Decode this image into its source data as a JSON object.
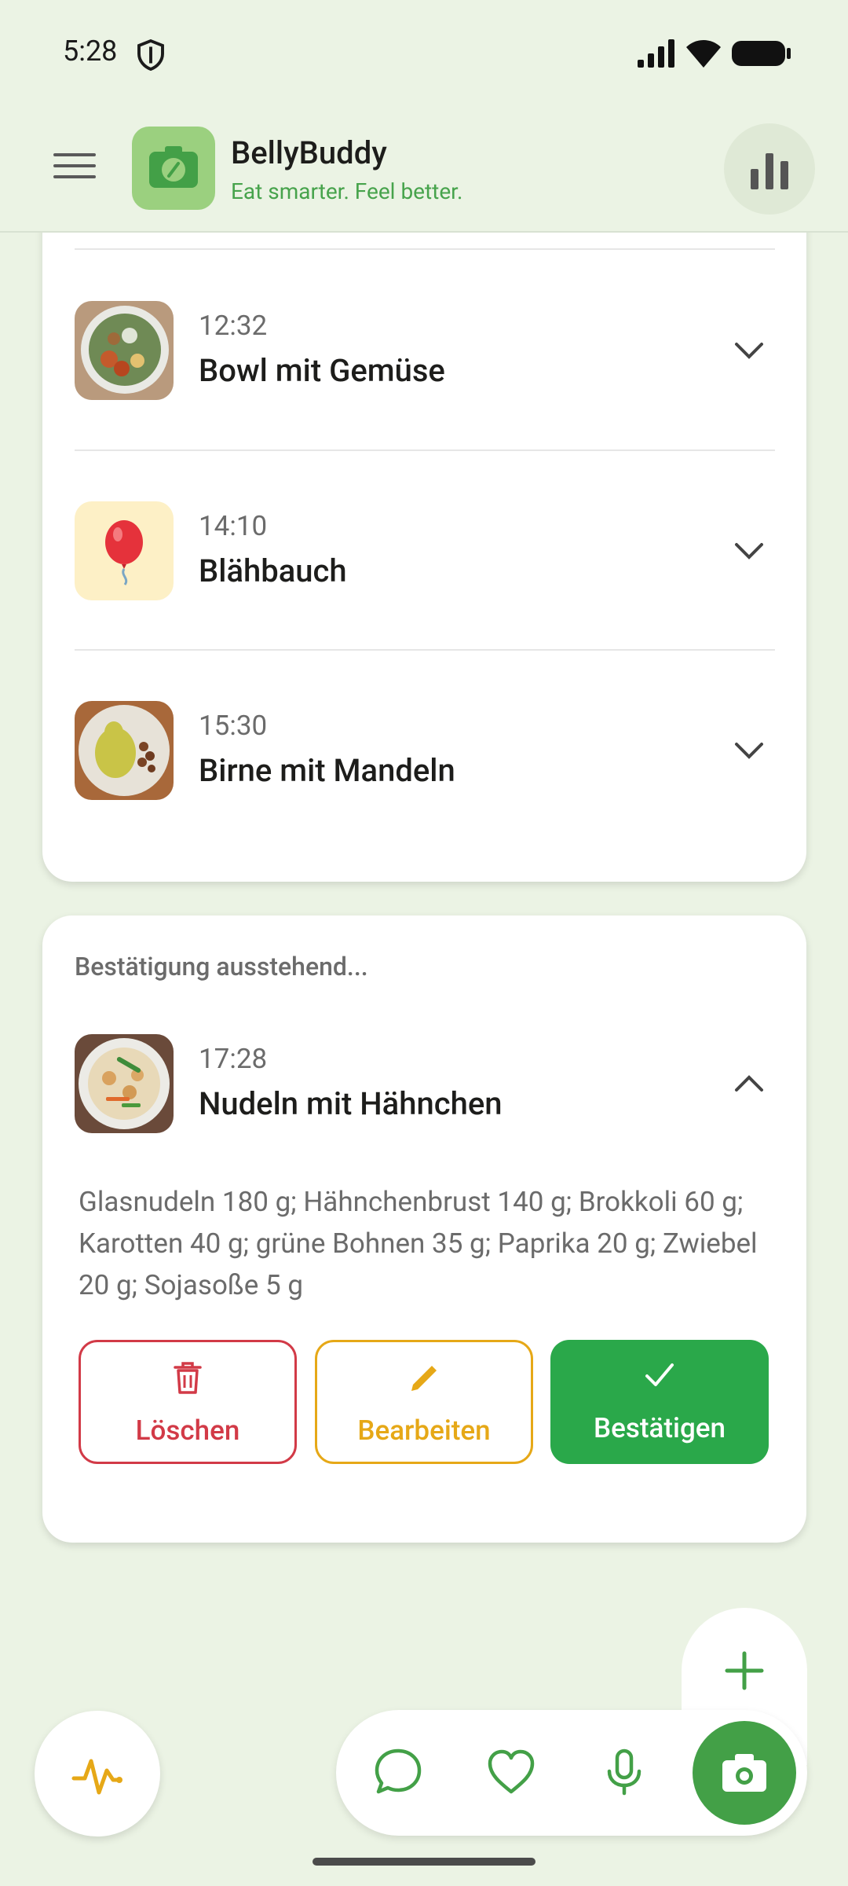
{
  "status_bar": {
    "time": "5:28"
  },
  "app_bar": {
    "title": "BellyBuddy",
    "subtitle": "Eat smarter. Feel better."
  },
  "timeline": {
    "entries": [
      {
        "time": "12:32",
        "title": "Bowl mit Gemüse",
        "thumb": "vegetable-bowl-photo"
      },
      {
        "time": "14:10",
        "title": "Blähbauch",
        "thumb": "balloon-emoji"
      },
      {
        "time": "15:30",
        "title": "Birne mit Mandeln",
        "thumb": "pear-almonds-photo"
      }
    ]
  },
  "pending": {
    "header": "Bestätigung ausstehend...",
    "entry": {
      "time": "17:28",
      "title": "Nudeln mit Hähnchen",
      "thumb": "noodles-chicken-photo"
    },
    "ingredients": "Glasnudeln 180 g; Hähnchenbrust 140 g; Brokkoli 60 g; Karotten 40 g; grüne Bohnen 35 g; Paprika 20 g; Zwiebel 20 g; Sojasoße 5 g",
    "buttons": {
      "delete": "Löschen",
      "edit": "Bearbeiten",
      "confirm": "Bestätigen"
    }
  },
  "colors": {
    "background": "#ebf3e4",
    "brand_green": "#47a34c",
    "delete_red": "#d23a47",
    "edit_amber": "#e6a817",
    "confirm_green": "#2aa84a"
  }
}
